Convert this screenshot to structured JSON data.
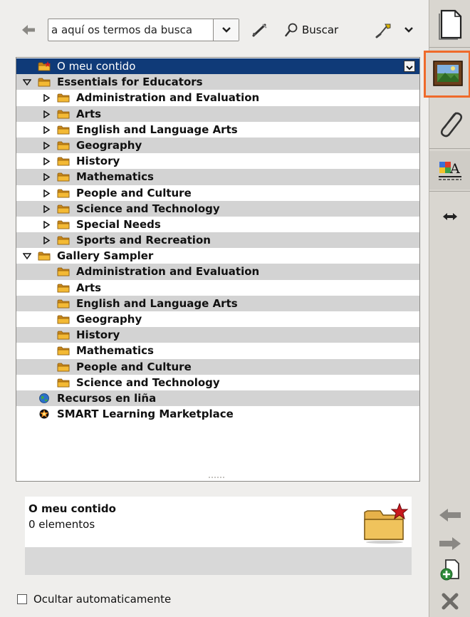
{
  "toolbar": {
    "search_placeholder": "a aquí os termos da busca",
    "search_button_label": "Buscar",
    "icons": [
      "back-arrow-icon",
      "dropdown-caret-icon",
      "wand-icon",
      "magnifier-icon",
      "brush-icon",
      "caret-down-icon"
    ]
  },
  "tree": {
    "rows": [
      {
        "label": "O meu contido",
        "level": 0,
        "expander": "none",
        "icon": "my-content-folder-icon",
        "selected": true,
        "stripe": false,
        "dropdown": true
      },
      {
        "label": "Essentials for Educators",
        "level": 0,
        "expander": "open",
        "icon": "folder-icon",
        "selected": false,
        "stripe": true
      },
      {
        "label": "Administration and Evaluation",
        "level": 1,
        "expander": "closed",
        "icon": "folder-icon",
        "selected": false,
        "stripe": false
      },
      {
        "label": "Arts",
        "level": 1,
        "expander": "closed",
        "icon": "folder-icon",
        "selected": false,
        "stripe": true
      },
      {
        "label": "English and Language Arts",
        "level": 1,
        "expander": "closed",
        "icon": "folder-icon",
        "selected": false,
        "stripe": false
      },
      {
        "label": "Geography",
        "level": 1,
        "expander": "closed",
        "icon": "folder-icon",
        "selected": false,
        "stripe": true
      },
      {
        "label": "History",
        "level": 1,
        "expander": "closed",
        "icon": "folder-icon",
        "selected": false,
        "stripe": false
      },
      {
        "label": "Mathematics",
        "level": 1,
        "expander": "closed",
        "icon": "folder-icon",
        "selected": false,
        "stripe": true
      },
      {
        "label": "People and Culture",
        "level": 1,
        "expander": "closed",
        "icon": "folder-icon",
        "selected": false,
        "stripe": false
      },
      {
        "label": "Science and Technology",
        "level": 1,
        "expander": "closed",
        "icon": "folder-icon",
        "selected": false,
        "stripe": true
      },
      {
        "label": "Special Needs",
        "level": 1,
        "expander": "closed",
        "icon": "folder-icon",
        "selected": false,
        "stripe": false
      },
      {
        "label": "Sports and Recreation",
        "level": 1,
        "expander": "closed",
        "icon": "folder-icon",
        "selected": false,
        "stripe": true
      },
      {
        "label": "Gallery Sampler",
        "level": 0,
        "expander": "open",
        "icon": "folder-icon",
        "selected": false,
        "stripe": false
      },
      {
        "label": "Administration and Evaluation",
        "level": 1,
        "expander": "none",
        "icon": "folder-icon",
        "selected": false,
        "stripe": true
      },
      {
        "label": "Arts",
        "level": 1,
        "expander": "none",
        "icon": "folder-icon",
        "selected": false,
        "stripe": false
      },
      {
        "label": "English and Language Arts",
        "level": 1,
        "expander": "none",
        "icon": "folder-icon",
        "selected": false,
        "stripe": true
      },
      {
        "label": "Geography",
        "level": 1,
        "expander": "none",
        "icon": "folder-icon",
        "selected": false,
        "stripe": false
      },
      {
        "label": "History",
        "level": 1,
        "expander": "none",
        "icon": "folder-icon",
        "selected": false,
        "stripe": true
      },
      {
        "label": "Mathematics",
        "level": 1,
        "expander": "none",
        "icon": "folder-icon",
        "selected": false,
        "stripe": false
      },
      {
        "label": "People and Culture",
        "level": 1,
        "expander": "none",
        "icon": "folder-icon",
        "selected": false,
        "stripe": true
      },
      {
        "label": "Science and Technology",
        "level": 1,
        "expander": "none",
        "icon": "folder-icon",
        "selected": false,
        "stripe": false
      },
      {
        "label": "Recursos en liña",
        "level": 0,
        "expander": "none",
        "icon": "globe-icon",
        "selected": false,
        "stripe": true
      },
      {
        "label": "SMART Learning Marketplace",
        "level": 0,
        "expander": "none",
        "icon": "marketplace-icon",
        "selected": false,
        "stripe": false
      }
    ]
  },
  "info": {
    "title": "O meu contido",
    "count": "0 elementos"
  },
  "autohide": {
    "label": "Ocultar automaticamente",
    "checked": false
  },
  "rail": {
    "top_icons": [
      "page-sorter-icon",
      "gallery-icon",
      "attachments-icon",
      "properties-icon",
      "resize-arrows-icon"
    ],
    "bottom_icons": [
      "arrow-left-icon",
      "arrow-right-icon",
      "add-page-icon",
      "delete-icon"
    ],
    "active_tab": "gallery-icon",
    "active_color": "#ef6a2a"
  },
  "colors": {
    "selection": "#0f3a78",
    "stripe": "#d3d3d3",
    "folder": "#e9a620"
  }
}
